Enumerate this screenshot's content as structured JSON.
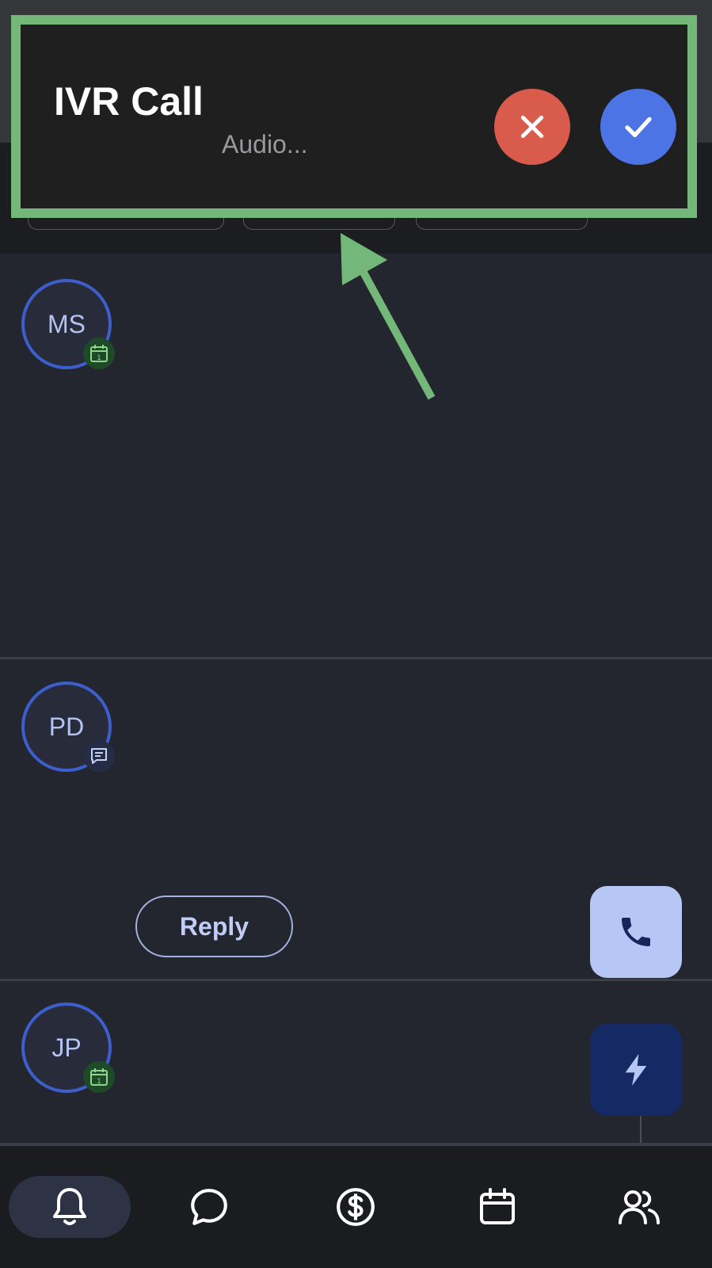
{
  "call_banner": {
    "title": "IVR Call",
    "subtitle": "Audio..."
  },
  "notifications": [
    {
      "initials": "MS",
      "badge_icon": "calendar-icon"
    },
    {
      "initials": "PD",
      "badge_icon": "message-icon",
      "action_label": "Reply"
    },
    {
      "initials": "JP",
      "badge_icon": "calendar-icon"
    }
  ],
  "badge_calendar_day": "1",
  "fabs": {
    "phone_icon": "phone-icon",
    "quick_action_icon": "bolt-icon"
  },
  "bottom_nav": [
    {
      "icon": "bell-icon",
      "active": true
    },
    {
      "icon": "chat-icon",
      "active": false
    },
    {
      "icon": "dollar-icon",
      "active": false
    },
    {
      "icon": "calendar-icon",
      "active": false
    },
    {
      "icon": "people-icon",
      "active": false
    }
  ],
  "colors": {
    "banner_outline": "#73b779",
    "decline": "#d85b4b",
    "accept": "#4c74e4",
    "avatar_ring": "#3d5fcc",
    "fab_phone": "#b7c7f5",
    "fab_bolt": "#152a64"
  }
}
